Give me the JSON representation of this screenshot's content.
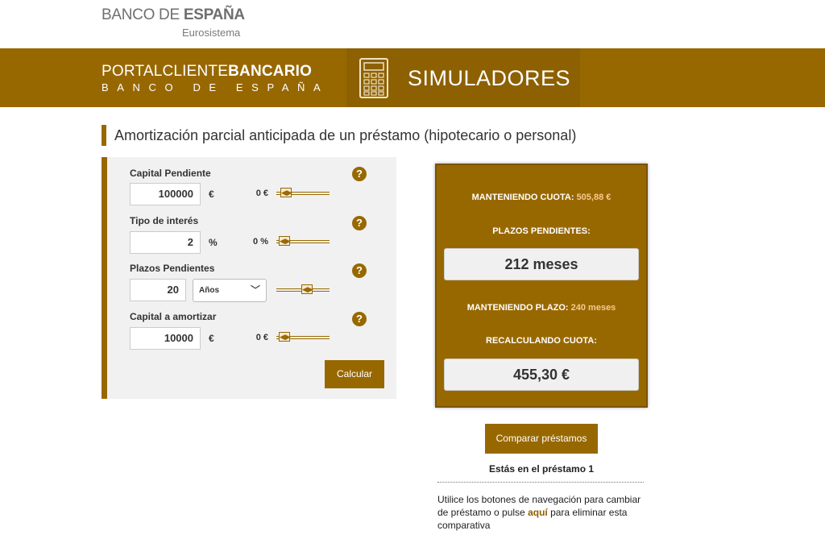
{
  "header": {
    "logo_light": "BANCO DE ",
    "logo_bold": "ESPAÑA",
    "logo_sub": "Eurosistema",
    "portal_light": "PORTALCLIENTE",
    "portal_bold": "BANCARIO",
    "portal_sub": "BANCO DE ESPAÑA",
    "section": "SIMULADORES",
    "band_color": "#986800"
  },
  "page": {
    "title": "Amortización parcial anticipada de un préstamo (hipotecario o personal)"
  },
  "form": {
    "capital": {
      "label": "Capital Pendiente",
      "value": "100000",
      "unit": "€",
      "min": "0 €",
      "slider_level": 0.1
    },
    "interes": {
      "label": "Tipo de interés",
      "value": "2",
      "unit": "%",
      "min": "0 %",
      "slider_level": 0.05
    },
    "plazos": {
      "label": "Plazos Pendientes",
      "value": "20",
      "period": "Años",
      "slider_level": 0.6
    },
    "amortizar": {
      "label": "Capital a amortizar",
      "value": "10000",
      "unit": "€",
      "min": "0 €",
      "slider_level": 0.05
    },
    "help": "?",
    "calc_button": "Calcular"
  },
  "results": {
    "cuota_label": "MANTENIENDO CUOTA: ",
    "cuota_value": "505,88 €",
    "plazos_label": "PLAZOS PENDIENTES:",
    "plazos_value": "212 meses",
    "plazo_label": "MANTENIENDO PLAZO: ",
    "plazo_value": "240 meses",
    "recalc_label": "RECALCULANDO CUOTA:",
    "recalc_value": "455,30 €"
  },
  "compare": {
    "button": "Comparar préstamos",
    "status": "Estás en el préstamo 1",
    "text_before": "Utilice los botones de navegación para cambiar de préstamo o pulse ",
    "link": "aquí",
    "text_after": " para eliminar esta comparativa"
  }
}
